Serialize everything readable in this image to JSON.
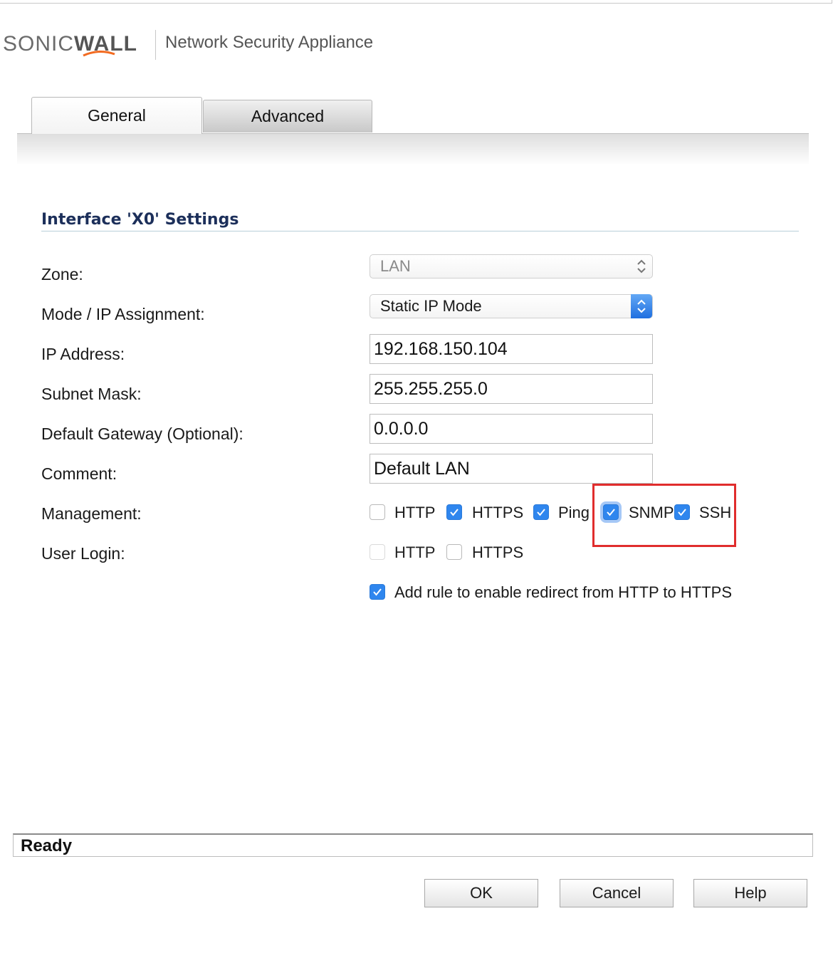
{
  "header": {
    "brand_light": "SONIC",
    "brand_bold": "WALL",
    "product": "Network Security Appliance"
  },
  "tabs": [
    {
      "label": "General",
      "active": true
    },
    {
      "label": "Advanced",
      "active": false
    }
  ],
  "section": {
    "title": "Interface 'X0' Settings"
  },
  "form": {
    "zone": {
      "label": "Zone:",
      "value": "LAN",
      "disabled": true
    },
    "mode": {
      "label": "Mode / IP Assignment:",
      "value": "Static IP Mode"
    },
    "ip_address": {
      "label": "IP Address:",
      "value": "192.168.150.104"
    },
    "subnet_mask": {
      "label": "Subnet Mask:",
      "value": "255.255.255.0"
    },
    "gateway": {
      "label": "Default Gateway (Optional):",
      "value": "0.0.0.0"
    },
    "comment": {
      "label": "Comment:",
      "value": "Default LAN"
    },
    "management": {
      "label": "Management:",
      "options": [
        {
          "label": "HTTP",
          "checked": false
        },
        {
          "label": "HTTPS",
          "checked": true
        },
        {
          "label": "Ping",
          "checked": true
        },
        {
          "label": "SNMP",
          "checked": true
        },
        {
          "label": "SSH",
          "checked": true
        }
      ]
    },
    "user_login": {
      "label": "User Login:",
      "options": [
        {
          "label": "HTTP",
          "checked": false
        },
        {
          "label": "HTTPS",
          "checked": false
        }
      ]
    },
    "redirect": {
      "label": "Add rule to enable redirect from HTTP to HTTPS",
      "checked": true
    }
  },
  "status": {
    "text": "Ready"
  },
  "buttons": {
    "ok": "OK",
    "cancel": "Cancel",
    "help": "Help"
  },
  "colors": {
    "accent": "#2f86ee",
    "highlight": "#e02d2d",
    "section_title": "#1c2f5a",
    "logo_swoosh": "#f26b21"
  }
}
